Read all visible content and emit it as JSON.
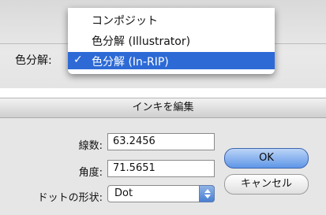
{
  "separation_menu": {
    "label": "色分解:",
    "items": [
      {
        "label": "コンポジット",
        "checked": false
      },
      {
        "label": "色分解 (Illustrator)",
        "checked": false
      },
      {
        "label": "色分解 (In-RIP)",
        "checked": true
      }
    ],
    "check_mark": "✓"
  },
  "ink_dialog": {
    "title": "インキを編集",
    "screen_ruling_label": "線数:",
    "screen_ruling_value": "63.2456",
    "angle_label": "角度:",
    "angle_value": "71.5651",
    "dot_shape_label": "ドットの形状:",
    "dot_shape_value": "Dot",
    "ok_label": "OK",
    "cancel_label": "キャンセル"
  },
  "colors": {
    "selection": "#2d6ad6",
    "default_button": "#5f96e7"
  }
}
